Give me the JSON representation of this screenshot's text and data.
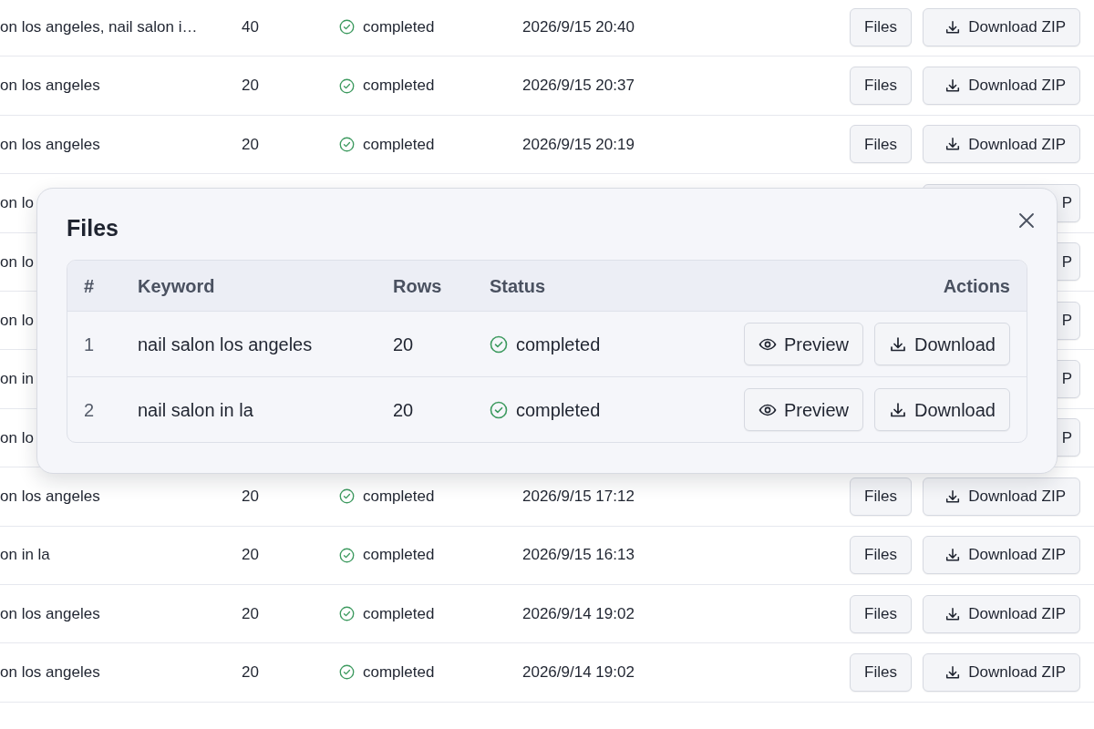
{
  "jobs": [
    {
      "keyword": "on los angeles, nail salon i…",
      "rows": "40",
      "status": "completed",
      "date": "2026/9/15 20:40",
      "files_button": "Files",
      "zip_button": "Download ZIP"
    },
    {
      "keyword": "on los angeles",
      "rows": "20",
      "status": "completed",
      "date": "2026/9/15 20:37",
      "files_button": "Files",
      "zip_button": "Download ZIP"
    },
    {
      "keyword": "on los angeles",
      "rows": "20",
      "status": "completed",
      "date": "2026/9/15 20:19",
      "files_button": "Files",
      "zip_button": "Download ZIP"
    },
    {
      "keyword": "on lo",
      "zip_button": "P"
    },
    {
      "keyword": "on lo",
      "zip_button": "P"
    },
    {
      "keyword": "on lo",
      "zip_button": "P"
    },
    {
      "keyword": "on in",
      "zip_button": "P"
    },
    {
      "keyword": "on lo",
      "zip_button": "P"
    },
    {
      "keyword": "on los angeles",
      "rows": "20",
      "status": "completed",
      "date": "2026/9/15 17:12",
      "files_button": "Files",
      "zip_button": "Download ZIP"
    },
    {
      "keyword": "on in la",
      "rows": "20",
      "status": "completed",
      "date": "2026/9/15 16:13",
      "files_button": "Files",
      "zip_button": "Download ZIP"
    },
    {
      "keyword": "on los angeles",
      "rows": "20",
      "status": "completed",
      "date": "2026/9/14 19:02",
      "files_button": "Files",
      "zip_button": "Download ZIP"
    },
    {
      "keyword": "on los angeles",
      "rows": "20",
      "status": "completed",
      "date": "2026/9/14 19:02",
      "files_button": "Files",
      "zip_button": "Download ZIP"
    }
  ],
  "modal": {
    "title": "Files",
    "columns": [
      "#",
      "Keyword",
      "Rows",
      "Status",
      "Actions"
    ],
    "rows": [
      {
        "index": "1",
        "keyword": "nail salon los angeles",
        "rows": "20",
        "status": "completed",
        "preview_button": "Preview",
        "download_button": "Download"
      },
      {
        "index": "2",
        "keyword": "nail salon in la",
        "rows": "20",
        "status": "completed",
        "preview_button": "Preview",
        "download_button": "Download"
      }
    ]
  }
}
